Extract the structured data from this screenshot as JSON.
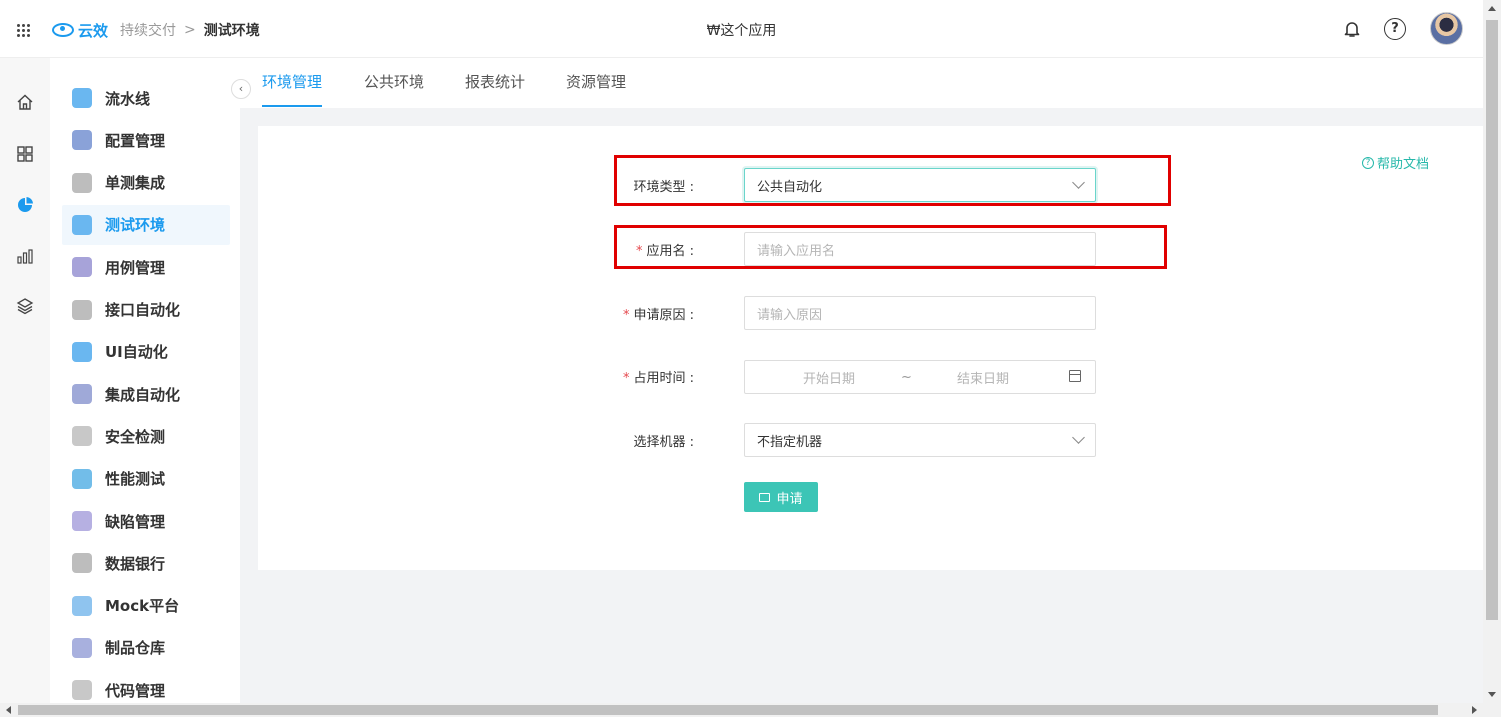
{
  "header": {
    "logo_text": "云效",
    "breadcrumb_parent": "持续交付",
    "breadcrumb_sep": ">",
    "breadcrumb_current": "测试环境",
    "app_title": "₩这个应用",
    "icons": [
      "apps-grid-icon",
      "bell-icon",
      "help-icon",
      "avatar"
    ]
  },
  "rail": {
    "items": [
      "home-icon",
      "dashboard-icon",
      "pie-chart-icon",
      "bar-chart-icon",
      "layers-icon"
    ]
  },
  "sidebar": {
    "items": [
      {
        "label": "流水线",
        "icon": "pipeline-icon",
        "color": "#6ab7f0"
      },
      {
        "label": "配置管理",
        "icon": "wrench-icon",
        "color": "#8aa2d8"
      },
      {
        "label": "单测集成",
        "icon": "unit-test-icon",
        "color": "#bdbdbd"
      },
      {
        "label": "测试环境",
        "icon": "cloud-icon",
        "color": "#6ab7f0",
        "active": true
      },
      {
        "label": "用例管理",
        "icon": "case-icon",
        "color": "#a7a3d9"
      },
      {
        "label": "接口自动化",
        "icon": "api-icon",
        "color": "#bdbdbd"
      },
      {
        "label": "UI自动化",
        "icon": "ui-icon",
        "color": "#6ab7f0"
      },
      {
        "label": "集成自动化",
        "icon": "integration-icon",
        "color": "#9fa9d8"
      },
      {
        "label": "安全检测",
        "icon": "security-icon",
        "color": "#c8c8c8"
      },
      {
        "label": "性能测试",
        "icon": "performance-icon",
        "color": "#72bde9"
      },
      {
        "label": "缺陷管理",
        "icon": "bug-icon",
        "color": "#b6b0e2"
      },
      {
        "label": "数据银行",
        "icon": "data-bank-icon",
        "color": "#bdbdbd"
      },
      {
        "label": "Mock平台",
        "icon": "mock-icon",
        "color": "#8fc4ef"
      },
      {
        "label": "制品仓库",
        "icon": "artifact-icon",
        "color": "#a8b0de"
      },
      {
        "label": "代码管理",
        "icon": "code-icon",
        "color": "#c8c8c8"
      }
    ]
  },
  "tabs": [
    {
      "label": "环境管理",
      "active": true
    },
    {
      "label": "公共环境"
    },
    {
      "label": "报表统计"
    },
    {
      "label": "资源管理"
    }
  ],
  "form": {
    "help_link": "帮助文档",
    "env_type": {
      "label": "环境类型",
      "value": "公共自动化"
    },
    "app_name": {
      "label": "应用名",
      "placeholder": "请输入应用名",
      "required": true
    },
    "reason": {
      "label": "申请原因",
      "placeholder": "请输入原因",
      "required": true
    },
    "duration": {
      "label": "占用时间",
      "start_placeholder": "开始日期",
      "sep": "~",
      "end_placeholder": "结束日期",
      "required": true
    },
    "machine": {
      "label": "选择机器",
      "value": "不指定机器"
    },
    "colon": ":",
    "required_mark": "*",
    "submit_label": "申请"
  },
  "colors": {
    "brand": "#1b9aee",
    "teal": "#3cc5b6",
    "annotation": "#e00000",
    "required": "#e5484d"
  }
}
